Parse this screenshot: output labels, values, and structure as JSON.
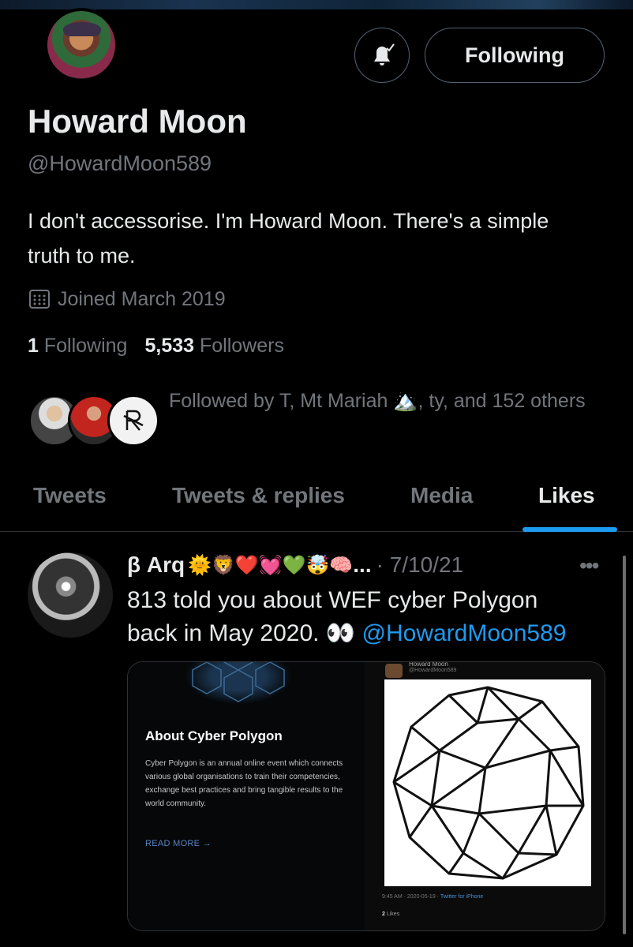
{
  "profile": {
    "name": "Howard Moon",
    "handle": "@HowardMoon589",
    "bio": "I don't accessorise. I'm Howard Moon. There's a simple truth to me.",
    "joined": "Joined March 2019",
    "following_count": "1",
    "following_label": "Following",
    "followers_count": "5,533",
    "followers_label": "Followers",
    "followed_by": "Followed by T, Mt Mariah 🏔️, ty, and 152 others"
  },
  "actions": {
    "following_button": "Following",
    "notify_icon": "bell-check-icon"
  },
  "tabs": [
    {
      "label": "Tweets",
      "active": false
    },
    {
      "label": "Tweets & replies",
      "active": false
    },
    {
      "label": "Media",
      "active": false
    },
    {
      "label": "Likes",
      "active": true
    }
  ],
  "tweet": {
    "author": "β Arq",
    "emojis": "🌞🦁❤️💓💚🤯🧠",
    "ellipsis": "...",
    "date": "· 7/10/21",
    "more_icon": "more-horizontal-icon",
    "text_line1": "813 told you about WEF cyber Polygon",
    "text_line2": "back in May 2020. 👀",
    "mention": "@HowardMoon589"
  },
  "media": {
    "left": {
      "title": "About Cyber Polygon",
      "description": "Cyber Polygon is an annual online event which connects various global organisations to train their competencies, exchange best practices and bring tangible results to the world community.",
      "read_more": "READ MORE →"
    },
    "right": {
      "name": "Howard Moon",
      "handle": "@HowardMoon589",
      "meta": "9:45 AM · 2020-05-19 · ",
      "source": "Twitter for iPhone",
      "likes_count": "2",
      "likes_label": "Likes"
    }
  },
  "colors": {
    "accent": "#1d9bf0",
    "text_primary": "#e7e9ea",
    "text_secondary": "#71767b",
    "border": "#536471"
  }
}
